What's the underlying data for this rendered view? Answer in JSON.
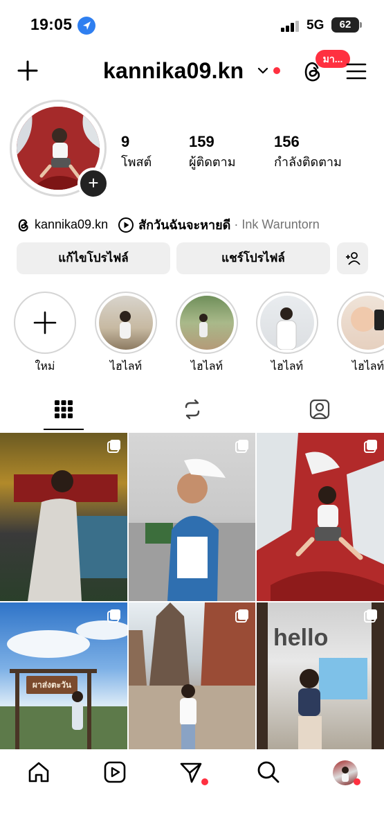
{
  "status_bar": {
    "time": "19:05",
    "network": "5G",
    "battery": "62"
  },
  "header": {
    "username": "kannika09.kn",
    "threads_badge": "มา..."
  },
  "profile": {
    "stats": [
      {
        "value": "9",
        "label": "โพสต์"
      },
      {
        "value": "159",
        "label": "ผู้ติดตาม"
      },
      {
        "value": "156",
        "label": "กำลังติดตาม"
      }
    ],
    "threads_handle": "kannika09.kn",
    "music_title": "สักวันฉันจะหายดี",
    "music_separator": " · ",
    "music_artist": "Ink Waruntorn"
  },
  "buttons": {
    "edit": "แก้ไขโปรไฟล์",
    "share": "แชร์โปรไฟล์"
  },
  "highlights": [
    {
      "label": "ใหม่"
    },
    {
      "label": "ไฮไลท์"
    },
    {
      "label": "ไฮไลท์"
    },
    {
      "label": "ไฮไลท์"
    },
    {
      "label": "ไฮไลท์"
    }
  ],
  "tile_text": {
    "sign": "ผาส่งตะวัน",
    "hello": "hello"
  },
  "colors": {
    "accent_red": "#ff3040",
    "button_bg": "#efefef",
    "location_blue": "#2f7ff0"
  },
  "icons": {
    "header": [
      "plus-icon",
      "chevron-down-icon",
      "threads-icon",
      "menu-icon"
    ],
    "tabs": [
      "grid-icon",
      "reels-icon",
      "tagged-icon"
    ],
    "nav": [
      "home-icon",
      "reels-icon",
      "send-icon",
      "search-icon",
      "profile-avatar"
    ]
  }
}
